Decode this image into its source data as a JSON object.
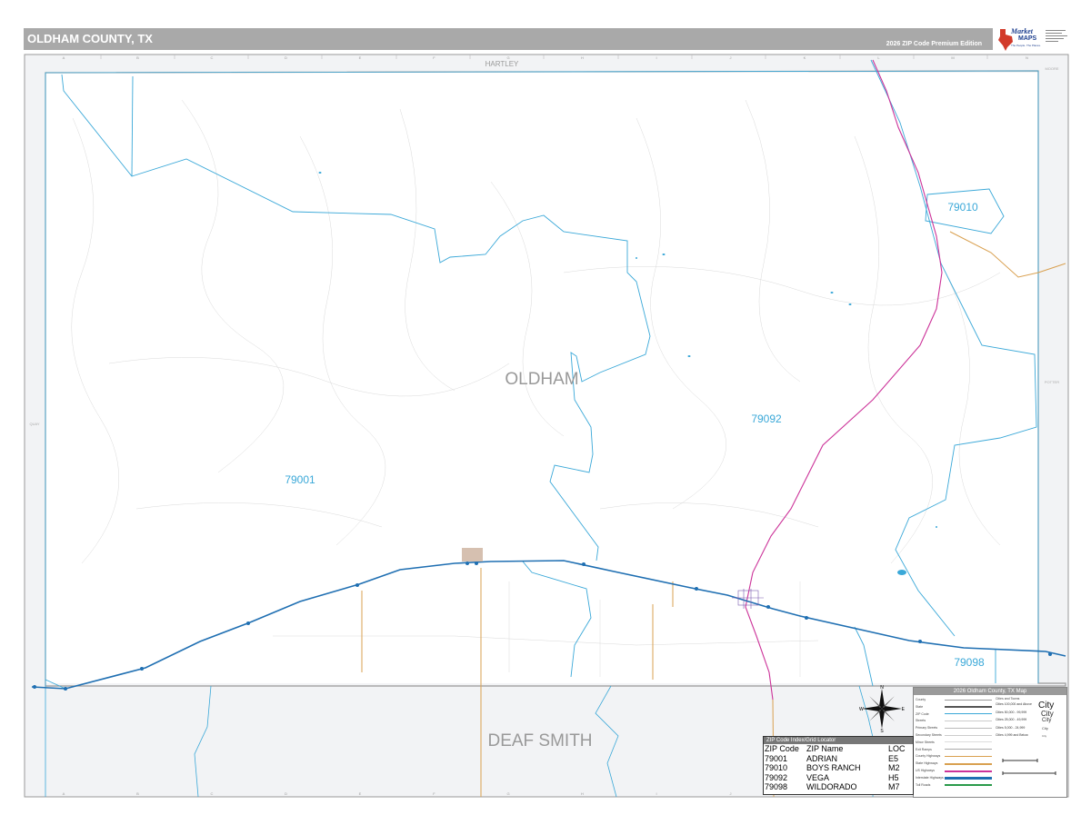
{
  "header": {
    "title": "OLDHAM COUNTY, TX",
    "edition": "2026 ZIP Code Premium Edition"
  },
  "logo": {
    "brand": "Market",
    "maps": "MAPS",
    "tagline": "The People. The Places."
  },
  "map": {
    "county_label": "OLDHAM",
    "neighbor_south": "DEAF SMITH",
    "neighbor_north": "HARTLEY",
    "neighbor_northeast": "MOORE",
    "neighbor_east": "POTTER",
    "neighbor_west": "QUAY",
    "zip_labels": [
      "79001",
      "79010",
      "79092",
      "79098"
    ],
    "grid_columns": [
      "A",
      "B",
      "C",
      "D",
      "E",
      "F",
      "G",
      "H",
      "I",
      "J",
      "K",
      "L",
      "M",
      "N"
    ],
    "colors": {
      "zip_boundary": "#3aa8d8",
      "zip_label": "#3aa8d8",
      "interstate": "#1f6fb2",
      "us_highway": "#cc3399",
      "state_highway": "#d9a050",
      "county_border": "#999999",
      "county_label": "#999999",
      "outside_county": "#f2f3f5"
    }
  },
  "compass": {
    "n": "N",
    "s": "S",
    "e": "E",
    "w": "W"
  },
  "legend": {
    "title": "2026 Oldham County, TX Map",
    "rows": [
      "County",
      "State",
      "ZIP Code",
      "Streets",
      "Primary Streets",
      "Secondary Streets",
      "Minor Streets",
      "Exit Ramps",
      "County Highways",
      "State Highways",
      "US Highways",
      "Interstate Highways",
      "Toll Roads"
    ],
    "size_header": "Cities and Towns",
    "sizes": [
      "Cities 100,000 and Above",
      "Cities 50,000 - 99,999",
      "Cities 25,000 - 49,999",
      "Cities 5,000 - 24,999",
      "Cities 4,999 and Below"
    ],
    "city_samples": [
      "City",
      "City",
      "City",
      "City",
      "City"
    ]
  },
  "zip_index": {
    "title": "ZIP Code Index/Grid Locator",
    "headers": [
      "ZIP Code",
      "ZIP Name",
      "LOC"
    ],
    "rows": [
      [
        "79001",
        "ADRIAN",
        "E5"
      ],
      [
        "79010",
        "BOYS RANCH",
        "M2"
      ],
      [
        "79092",
        "VEGA",
        "H5"
      ],
      [
        "79098",
        "WILDORADO",
        "M7"
      ]
    ]
  }
}
